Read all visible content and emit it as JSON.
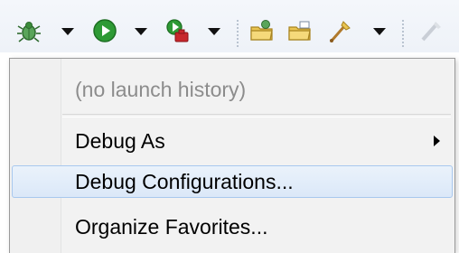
{
  "toolbar": {
    "icons": [
      "debug-bug-icon",
      "run-icon",
      "external-tools-icon",
      "open-folder-icon",
      "open-folder-icon",
      "brush-icon",
      "disabled-pen-icon"
    ],
    "colors": {
      "run_green": "#2e9a35",
      "bug_green": "#3b8c3a",
      "external_red": "#c8282d",
      "folder_yellow": "#e9c452"
    }
  },
  "menu": {
    "no_history_label": "(no launch history)",
    "debug_as_label": "Debug As",
    "debug_configurations_label": "Debug Configurations...",
    "organize_favorites_label": "Organize Favorites...",
    "highlight_color": "#dbe8f8",
    "highlight_border": "#a8c8ee"
  }
}
